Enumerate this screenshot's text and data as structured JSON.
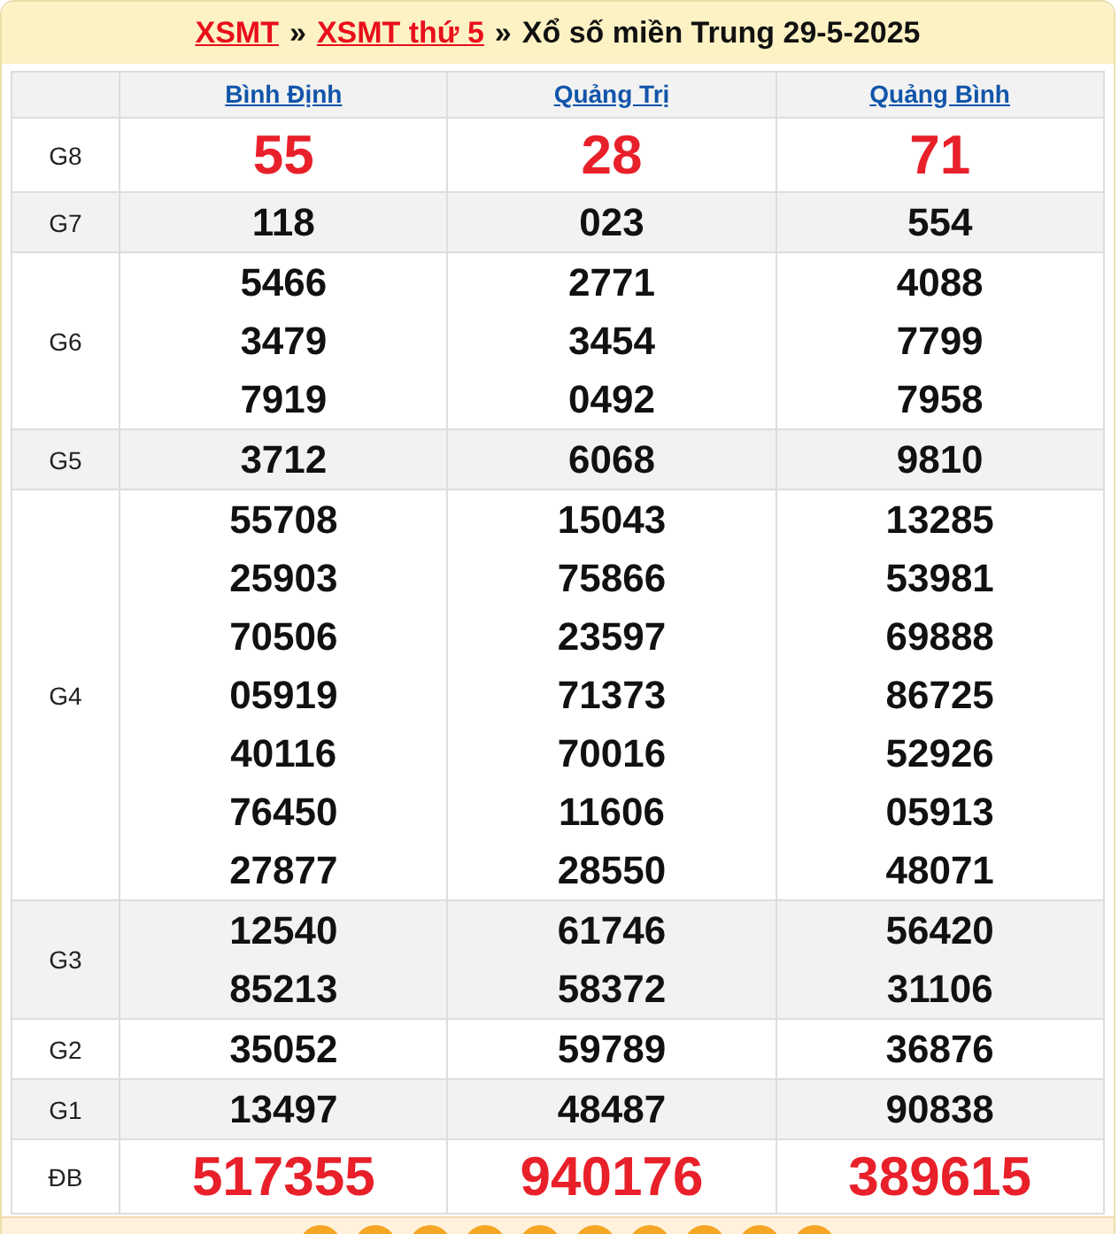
{
  "header": {
    "links": [
      "XSMT",
      "XSMT thứ 5"
    ],
    "separator": "»",
    "title": "Xổ số miền Trung 29-5-2025"
  },
  "columns": [
    "Bình Định",
    "Quảng Trị",
    "Quảng Bình"
  ],
  "prizes": [
    {
      "label": "G8",
      "kind": "highlight",
      "values": [
        [
          "55"
        ],
        [
          "28"
        ],
        [
          "71"
        ]
      ]
    },
    {
      "label": "G7",
      "kind": "normal",
      "values": [
        [
          "118"
        ],
        [
          "023"
        ],
        [
          "554"
        ]
      ]
    },
    {
      "label": "G6",
      "kind": "normal",
      "values": [
        [
          "5466",
          "3479",
          "7919"
        ],
        [
          "2771",
          "3454",
          "0492"
        ],
        [
          "4088",
          "7799",
          "7958"
        ]
      ]
    },
    {
      "label": "G5",
      "kind": "normal",
      "values": [
        [
          "3712"
        ],
        [
          "6068"
        ],
        [
          "9810"
        ]
      ]
    },
    {
      "label": "G4",
      "kind": "normal",
      "values": [
        [
          "55708",
          "25903",
          "70506",
          "05919",
          "40116",
          "76450",
          "27877"
        ],
        [
          "15043",
          "75866",
          "23597",
          "71373",
          "70016",
          "11606",
          "28550"
        ],
        [
          "13285",
          "53981",
          "69888",
          "86725",
          "52926",
          "05913",
          "48071"
        ]
      ]
    },
    {
      "label": "G3",
      "kind": "normal",
      "values": [
        [
          "12540",
          "85213"
        ],
        [
          "61746",
          "58372"
        ],
        [
          "56420",
          "31106"
        ]
      ]
    },
    {
      "label": "G2",
      "kind": "normal",
      "values": [
        [
          "35052"
        ],
        [
          "59789"
        ],
        [
          "36876"
        ]
      ]
    },
    {
      "label": "G1",
      "kind": "normal",
      "values": [
        [
          "13497"
        ],
        [
          "48487"
        ],
        [
          "90838"
        ]
      ]
    },
    {
      "label": "ĐB",
      "kind": "highlight",
      "values": [
        [
          "517355"
        ],
        [
          "940176"
        ],
        [
          "389615"
        ]
      ]
    }
  ]
}
